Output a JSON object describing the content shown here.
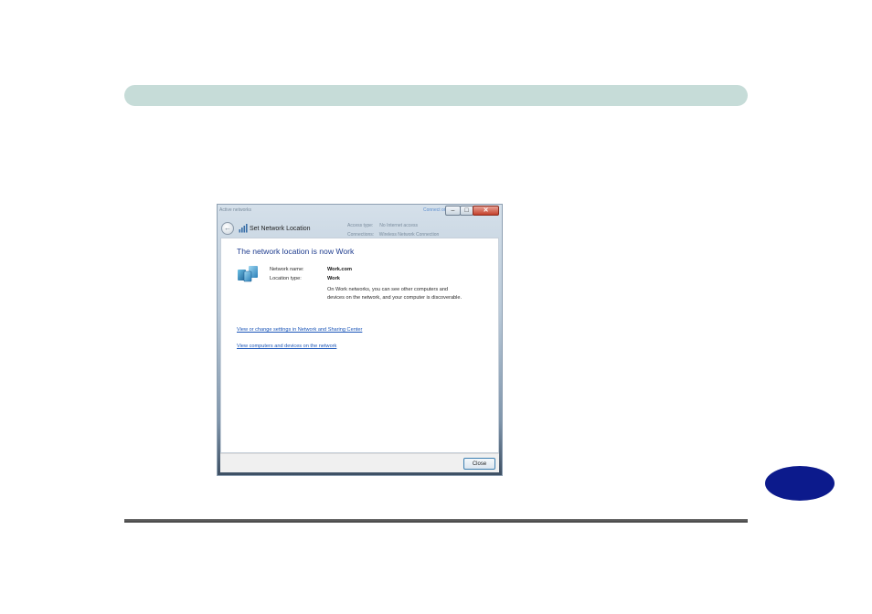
{
  "dialog": {
    "title": "Set Network Location",
    "window_buttons": {
      "minimize": "–",
      "maximize": "□",
      "close": "✕"
    },
    "back_arrow": "←",
    "heading": "The network location is now Work",
    "fields": [
      {
        "label": "Network name:",
        "value": "Work.com"
      },
      {
        "label": "Location type:",
        "value": "Work"
      }
    ],
    "description": "On Work networks, you can see other computers and devices on the network, and your computer is discoverable.",
    "links": [
      "View or change settings in Network and Sharing Center",
      "View computers and devices on the network"
    ],
    "close_button": "Close",
    "icons": {
      "back": "back-arrow-icon",
      "network": "network-icon",
      "computer": "work-network-icon"
    }
  },
  "colors": {
    "header_bar": "#c6dcd8",
    "page_tab": "#0c1a8c",
    "heading_text": "#1f3d8f",
    "link_text": "#1a55b8"
  }
}
